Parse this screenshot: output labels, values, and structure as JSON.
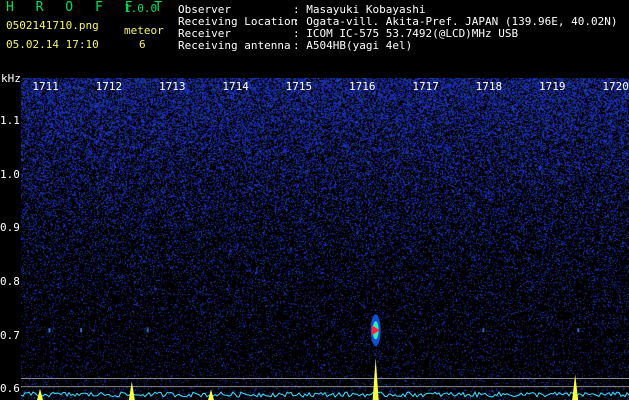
{
  "header": {
    "app_title": "H R O F F T",
    "version": "1.0.0",
    "file_name": "0502141710.png",
    "meteor_label": "meteor",
    "datetime": "05.02.14 17:10",
    "meteor_count": "6"
  },
  "info": [
    {
      "key": "Observer",
      "value": ": Masayuki Kobayashi"
    },
    {
      "key": "Receiving Location",
      "value": ": Ogata-vill. Akita-Pref. JAPAN (139.96E, 40.02N)"
    },
    {
      "key": "Receiver",
      "value": ": ICOM IC-575 53.7492(@LCD)MHz USB"
    },
    {
      "key": "Receiving antenna",
      "value": ": A504HB(yagi 4el)"
    }
  ],
  "colors": {
    "green": "#00e05a",
    "yellow": "#f5f56a",
    "noise_blue": "#1a2aa8",
    "meteor_red": "#ff2040",
    "trace_cyan": "#40e0ff",
    "trace_yellow": "#ffff40"
  },
  "chart_data": {
    "type": "heatmap",
    "y_unit": "kHz",
    "y_ticks": [
      "1.1",
      "1.0",
      "0.9",
      "0.8",
      "0.7",
      "0.6"
    ],
    "x_ticks": [
      "1711",
      "1712",
      "1713",
      "1714",
      "1715",
      "1716",
      "1717",
      "1718",
      "1719",
      "1720"
    ],
    "ylim": [
      0.58,
      1.18
    ],
    "xlim": [
      1710.6,
      1720.2
    ],
    "meteor_events": [
      {
        "time": 1716.2,
        "freq": 0.71,
        "strength": 1.0
      },
      {
        "time": 1711.05,
        "freq": 0.71,
        "strength": 0.35
      },
      {
        "time": 1711.55,
        "freq": 0.71,
        "strength": 0.3
      },
      {
        "time": 1712.6,
        "freq": 0.71,
        "strength": 0.25
      },
      {
        "time": 1717.9,
        "freq": 0.71,
        "strength": 0.2
      },
      {
        "time": 1719.4,
        "freq": 0.71,
        "strength": 0.3
      }
    ],
    "signal_peaks": [
      {
        "time": 1716.2,
        "level": 1.0
      },
      {
        "time": 1712.35,
        "level": 0.35
      },
      {
        "time": 1719.35,
        "level": 0.55
      },
      {
        "time": 1710.9,
        "level": 0.15
      },
      {
        "time": 1713.6,
        "level": 0.12
      }
    ]
  }
}
